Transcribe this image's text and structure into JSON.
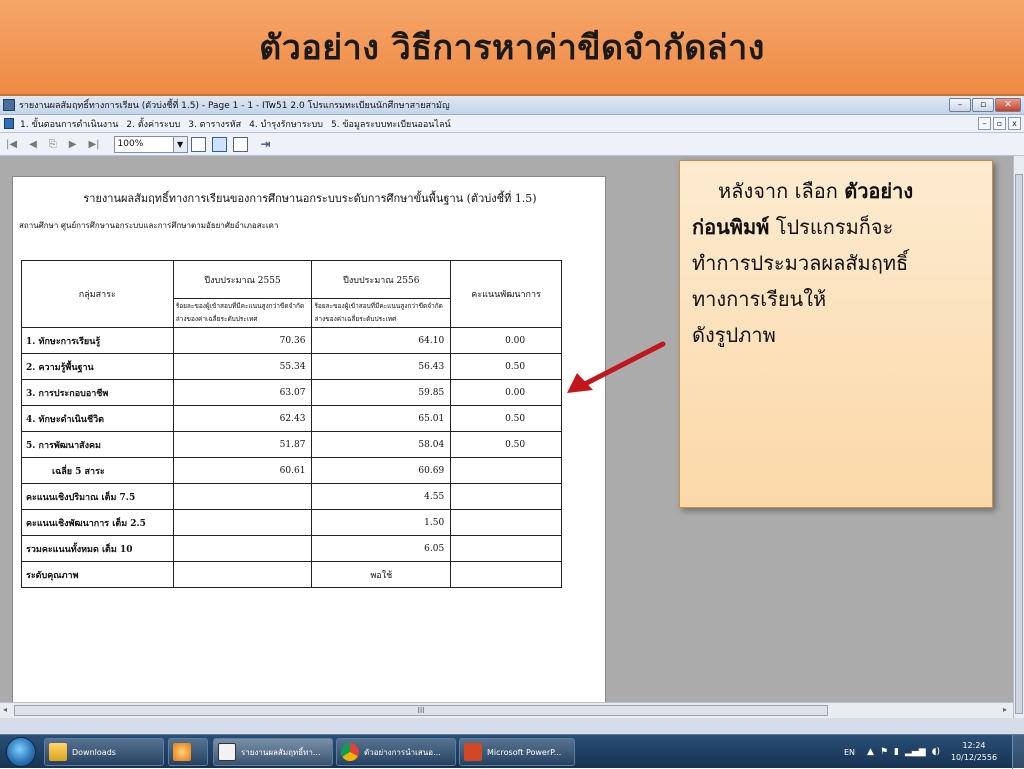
{
  "slide": {
    "title": "ตัวอย่าง  วิธีการหาค่าขีดจำกัดล่าง"
  },
  "window": {
    "title": "รายงานผลสัมฤทธิ์ทางการเรียน (ตัวบ่งชี้ที่ 1.5) - Page 1 - 1 - ITw51 2.0 โปรแกรมทะเบียนนักศึกษาสายสามัญ",
    "buttons": {
      "minimize": "–",
      "maximize": "▫",
      "close": "✕"
    }
  },
  "menu": {
    "items": [
      "1. ขั้นตอนการดำเนินงาน",
      "2. ตั้งค่าระบบ",
      "3. ตารางรหัส",
      "4. บำรุงรักษาระบบ",
      "5. ข้อมูลระบบทะเบียนออนไลน์"
    ],
    "mdi": [
      "–",
      "▫",
      "x"
    ]
  },
  "toolbar": {
    "first": "|◀",
    "prev": "◀",
    "copy": "⎘",
    "next": "▶",
    "last": "▶|",
    "zoom": "100%",
    "zoom_arrow": "▼",
    "exit": "⇥"
  },
  "report": {
    "title": "รายงานผลสัมฤทธิ์ทางการเรียนของการศึกษานอกระบบระดับการศึกษาขั้นพื้นฐาน (ตัวบ่งชี้ที่ 1.5)",
    "subtitle": "สถานศึกษา ศูนย์การศึกษานอกระบบและการศึกษาตามอัธยาศัยอำเภอสะเดา",
    "headers": {
      "group": "กลุ่มสาระ",
      "year1": "ปีงบประมาณ 2555",
      "year2": "ปีงบประมาณ 2556",
      "dev": "คะแนนพัฒนาการ",
      "sub1": "ร้อยละของผู้เข้าสอบที่มีคะแนนสูงกว่าขีดจำกัดล่างของค่าเฉลี่ยระดับประเทศ",
      "sub2": "ร้อยละของผู้เข้าสอบที่มีคะแนนสูงกว่าขีดจำกัดล่างของค่าเฉลี่ยระดับประเทศ"
    },
    "rows": [
      {
        "label": "1. ทักษะการเรียนรู้",
        "y1": "70.36",
        "y2": "64.10",
        "dev": "0.00"
      },
      {
        "label": "2. ความรู้พื้นฐาน",
        "y1": "55.34",
        "y2": "56.43",
        "dev": "0.50"
      },
      {
        "label": "3. การประกอบอาชีพ",
        "y1": "63.07",
        "y2": "59.85",
        "dev": "0.00"
      },
      {
        "label": "4. ทักษะดำเนินชีวิต",
        "y1": "62.43",
        "y2": "65.01",
        "dev": "0.50"
      },
      {
        "label": "5. การพัฒนาสังคม",
        "y1": "51.87",
        "y2": "58.04",
        "dev": "0.50"
      }
    ],
    "average": {
      "label": "เฉลี่ย 5  สาระ",
      "y1": "60.61",
      "y2": "60.69",
      "dev": ""
    },
    "summary": [
      {
        "label": "คะแนนเชิงปริมาณ เต็ม 7.5",
        "y1": "",
        "y2": "4.55",
        "dev": ""
      },
      {
        "label": "คะแนนเชิงพัฒนาการ เต็ม 2.5",
        "y1": "",
        "y2": "1.50",
        "dev": ""
      },
      {
        "label": "รวมคะแนนทั้งหมด เต็ม 10",
        "y1": "",
        "y2": "6.05",
        "dev": ""
      },
      {
        "label": "ระดับคุณภาพ",
        "y1": "",
        "y2": "พอใช้",
        "dev": ""
      }
    ]
  },
  "callout": {
    "line1_pre": "หลังจาก เลือก ",
    "line1_bold": "ตัวอย่าง",
    "line2_bold": "ก่อนพิมพ์",
    "line2_post": "  โปรแกรมก็จะ",
    "line3": "ทำการประมวลผลสัมฤทธิ์",
    "line4": "ทางการเรียนให้",
    "line5": "ดังรูปภาพ"
  },
  "scrollbar": {
    "left": "◂",
    "right": "▸",
    "grip": "III"
  },
  "taskbar": {
    "tasks": [
      "Downloads",
      "",
      "รายงานผลสัมฤทธิ์ทา...",
      "ตัวอย่างการนำเสนอ...",
      "Microsoft PowerP..."
    ],
    "lang": "EN",
    "tray_up": "▲",
    "time": "12:24",
    "date": "10/12/2556"
  },
  "colors": {
    "title_bar": "#ee8a45",
    "callout_bg": "#fbd8a8",
    "arrow": "#c0161c",
    "taskbar": "#1f3f63"
  }
}
